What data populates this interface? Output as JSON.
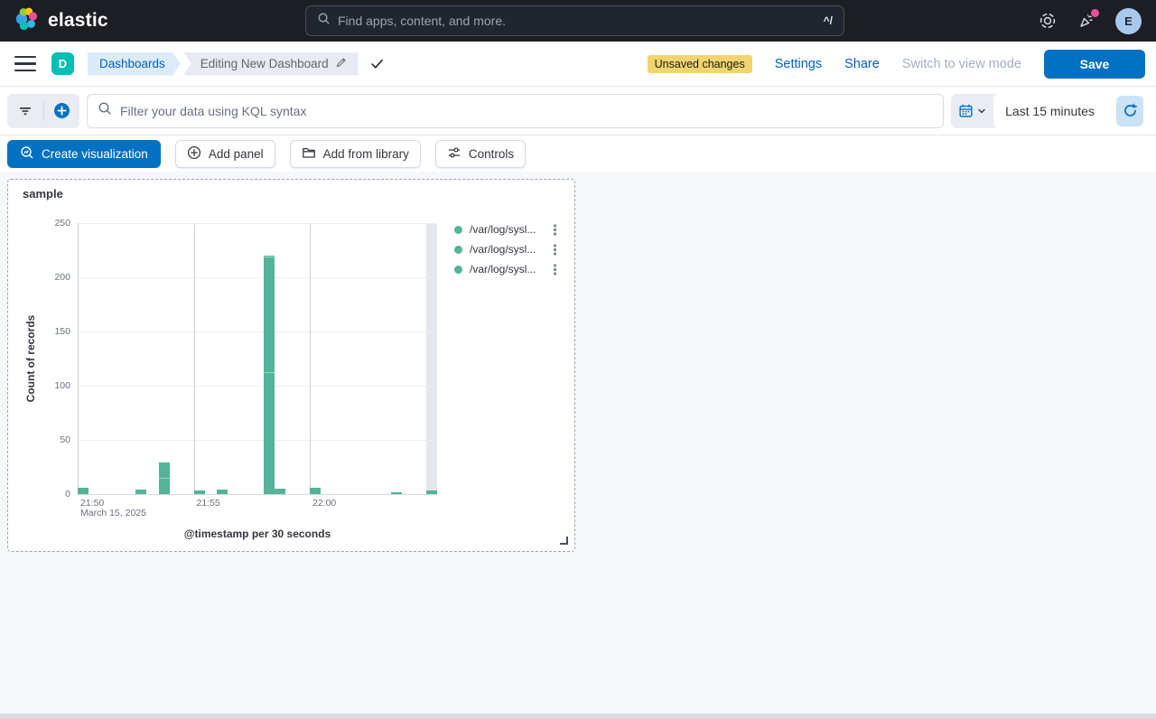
{
  "header": {
    "brand": "elastic",
    "search": {
      "placeholder": "Find apps, content, and more.",
      "shortcut": "^/"
    },
    "avatar_initial": "E"
  },
  "nav": {
    "app_badge": "D",
    "breadcrumbs": [
      "Dashboards",
      "Editing New Dashboard"
    ],
    "unsaved_badge": "Unsaved changes",
    "actions": {
      "settings": "Settings",
      "share": "Share",
      "view_mode": "Switch to view mode",
      "save": "Save"
    }
  },
  "filter_bar": {
    "kql_placeholder": "Filter your data using KQL syntax",
    "time_range": "Last 15 minutes"
  },
  "toolbar": {
    "create_visualization": "Create visualization",
    "add_panel": "Add panel",
    "add_from_library": "Add from library",
    "controls": "Controls"
  },
  "panel": {
    "title": "sample"
  },
  "chart_data": {
    "type": "bar",
    "title": "sample",
    "xlabel": "@timestamp per 30 seconds",
    "ylabel": "Count of records",
    "ylim": [
      0,
      250
    ],
    "y_ticks": [
      0,
      50,
      100,
      150,
      200,
      250
    ],
    "x_ticks": [
      "21:50",
      "21:55",
      "22:00"
    ],
    "x_date_label": "March 15, 2025",
    "bucket_seconds": 30,
    "grid": true,
    "legend_position": "right",
    "bar_color": "#54B399",
    "series_names": [
      "/var/log/sysl...",
      "/var/log/sysl...",
      "/var/log/sysl..."
    ],
    "bars": [
      {
        "time": "21:50:00",
        "total": 6
      },
      {
        "time": "21:52:30",
        "total": 4
      },
      {
        "time": "21:53:30",
        "total": 29,
        "segments": [
          14,
          15
        ]
      },
      {
        "time": "21:55:00",
        "total": 3
      },
      {
        "time": "21:56:00",
        "total": 4
      },
      {
        "time": "21:58:00",
        "total": 220,
        "segments": [
          112,
          106,
          2
        ]
      },
      {
        "time": "21:58:30",
        "total": 5
      },
      {
        "time": "22:00:00",
        "total": 6
      },
      {
        "time": "22:03:30",
        "total": 2
      },
      {
        "time": "22:05:00",
        "total": 3
      }
    ],
    "current_bucket_highlight": true
  },
  "colors": {
    "header_bg": "#1C1E24",
    "primary_button": "#0071C3",
    "link": "#0061C2",
    "app_badge": "#00BFB3",
    "warning_badge_bg": "#F0D46C",
    "bar_green": "#54B399",
    "accent_pink": "#F04E98"
  },
  "icons": {
    "search-icon": "magnifier",
    "help-icon": "life-ring",
    "news-icon": "party-horn",
    "menu-icon": "hamburger",
    "edit-icon": "pencil",
    "confirm-icon": "check",
    "filter-icon": "funnel-lines",
    "add-filter-icon": "plus-in-circle",
    "calendar-icon": "calendar",
    "chevron-down-icon": "chevron",
    "refresh-icon": "circular-arrow",
    "lens-icon": "magnifier-chart",
    "add-panel-icon": "plus-in-circle-outline",
    "library-icon": "folder",
    "controls-icon": "sliders",
    "legend-actions-icon": "boxes-vertical",
    "resize-icon": "corner-l"
  }
}
